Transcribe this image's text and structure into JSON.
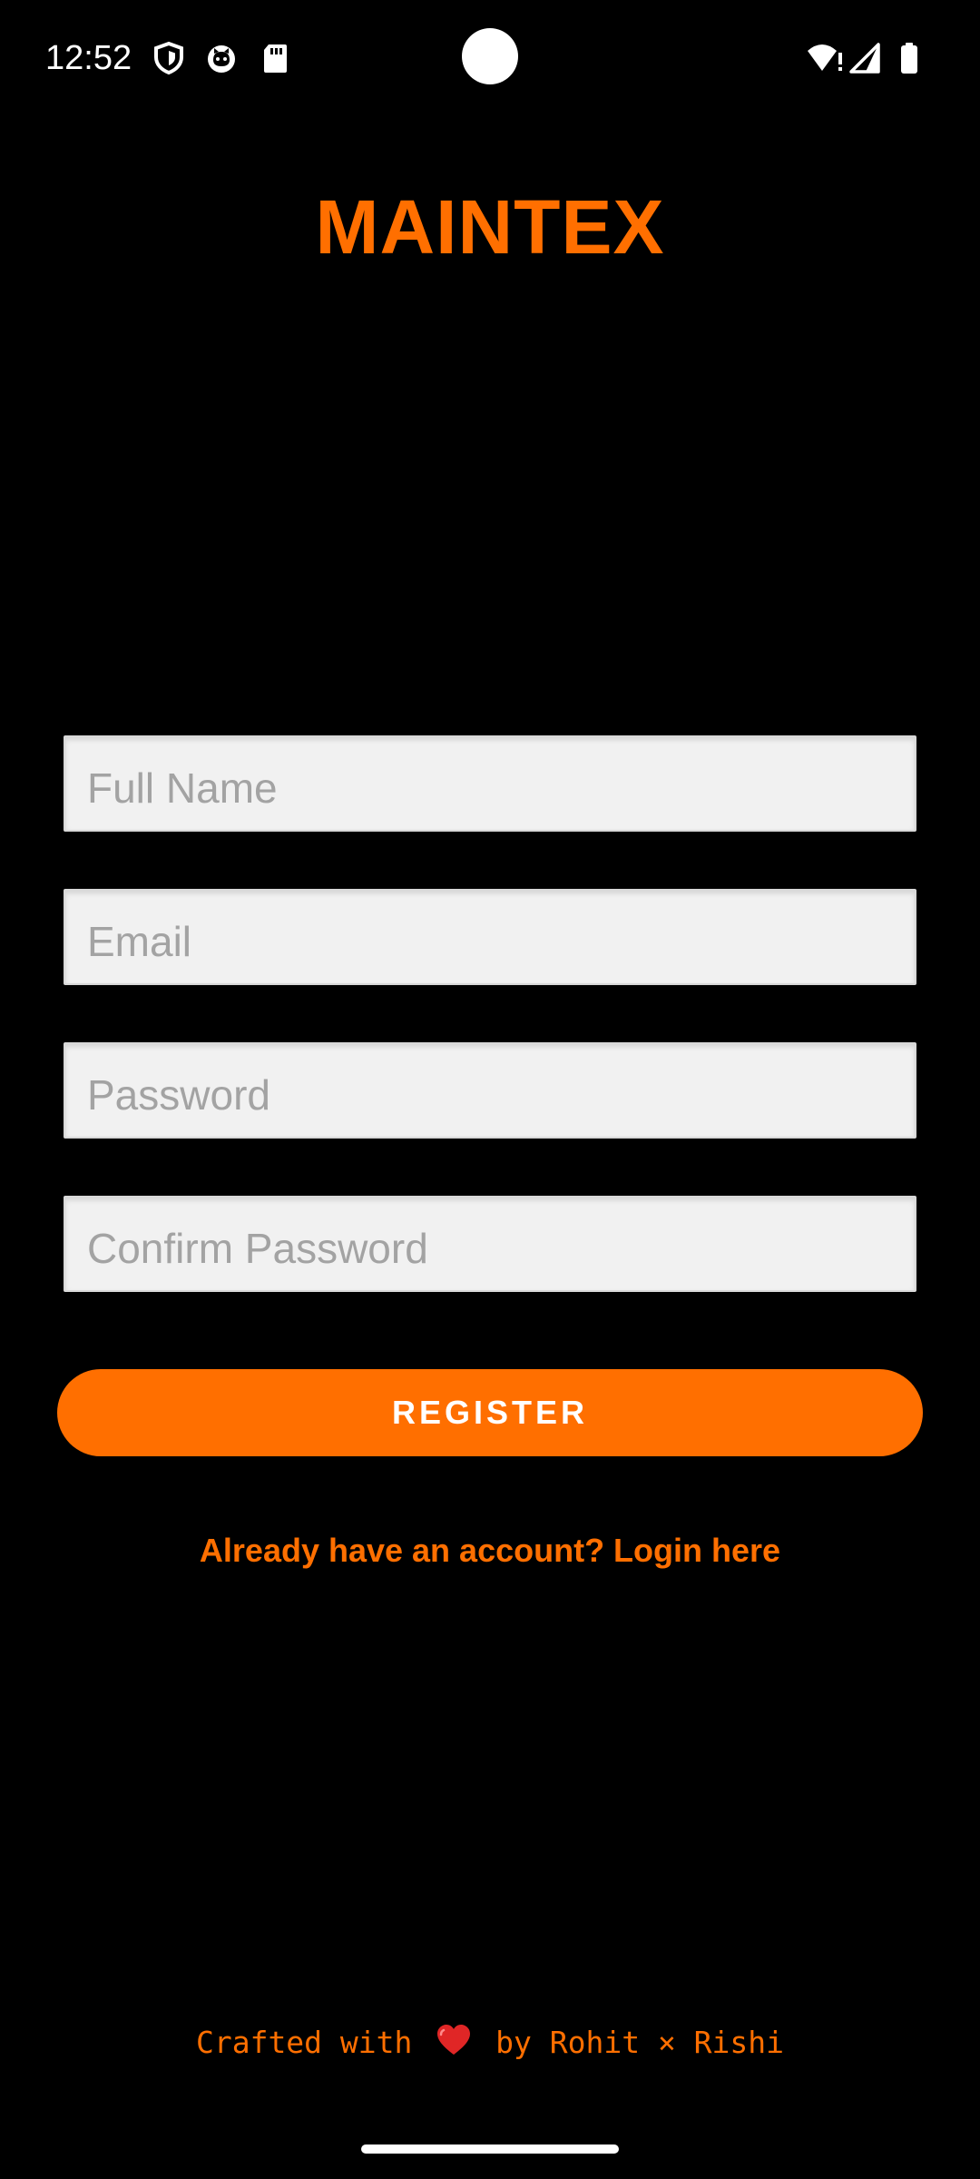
{
  "status_bar": {
    "time": "12:52",
    "left_icons": [
      "shield-icon",
      "cat-face-icon",
      "sd-card-icon"
    ],
    "right_icons": [
      "wifi-alert-icon",
      "cellular-signal-icon",
      "battery-icon"
    ]
  },
  "app": {
    "title": "MAINTEX"
  },
  "form": {
    "full_name": {
      "placeholder": "Full Name",
      "value": ""
    },
    "email": {
      "placeholder": "Email",
      "value": ""
    },
    "password": {
      "placeholder": "Password",
      "value": ""
    },
    "confirm_password": {
      "placeholder": "Confirm Password",
      "value": ""
    },
    "register_label": "REGISTER"
  },
  "login_link": "Already have an account? Login here",
  "footer": {
    "prefix": "Crafted with",
    "heart_icon": "heart-icon",
    "suffix": "by Rohit × Rishi"
  },
  "colors": {
    "accent": "#ff6f00",
    "background": "#000000",
    "field_background": "#f1f1f1",
    "placeholder": "#a3a3a3"
  }
}
